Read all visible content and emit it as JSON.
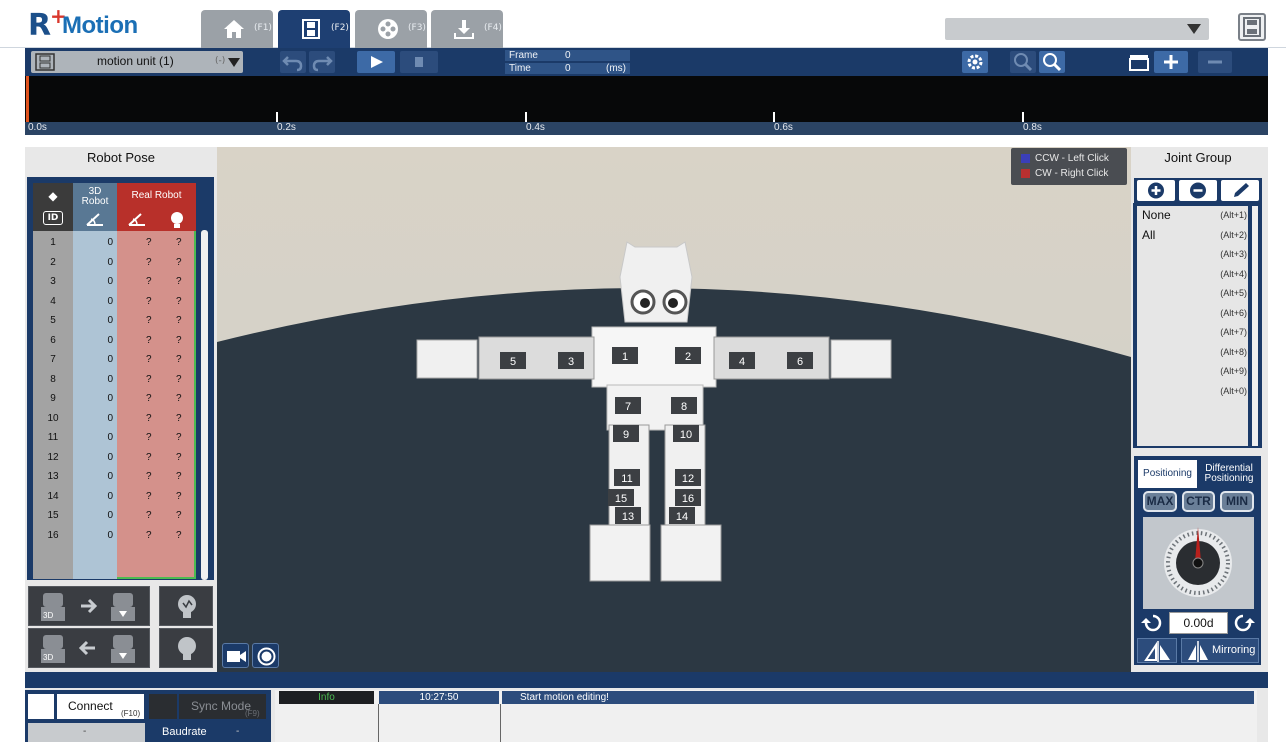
{
  "app": {
    "name": "Motion",
    "logo_r": "R",
    "logo_plus": "+"
  },
  "top_tabs": [
    {
      "icon": "home-icon",
      "key": "(F1)"
    },
    {
      "icon": "film-icon",
      "key": "(F2)"
    },
    {
      "icon": "film-reel-icon",
      "key": "(F3)"
    },
    {
      "icon": "download-icon",
      "key": "(F4)"
    }
  ],
  "toolbar": {
    "unit_label": "motion unit (1)",
    "unit_suffix": "(-)",
    "frame_label": "Frame",
    "frame_value": "0",
    "time_label": "Time",
    "time_value": "0",
    "time_unit": "(ms)"
  },
  "timeline": {
    "ticks": [
      "0.0s",
      "0.2s",
      "0.4s",
      "0.6s",
      "0.8s"
    ]
  },
  "robot_pose": {
    "title": "Robot Pose",
    "hdr_3d_a": "3D",
    "hdr_3d_b": "Robot",
    "hdr_real": "Real Robot",
    "hdr_id_badge": "ID",
    "rows": [
      {
        "id": "1",
        "v3d": "0",
        "ra": "?",
        "rl": "?"
      },
      {
        "id": "2",
        "v3d": "0",
        "ra": "?",
        "rl": "?"
      },
      {
        "id": "3",
        "v3d": "0",
        "ra": "?",
        "rl": "?"
      },
      {
        "id": "4",
        "v3d": "0",
        "ra": "?",
        "rl": "?"
      },
      {
        "id": "5",
        "v3d": "0",
        "ra": "?",
        "rl": "?"
      },
      {
        "id": "6",
        "v3d": "0",
        "ra": "?",
        "rl": "?"
      },
      {
        "id": "7",
        "v3d": "0",
        "ra": "?",
        "rl": "?"
      },
      {
        "id": "8",
        "v3d": "0",
        "ra": "?",
        "rl": "?"
      },
      {
        "id": "9",
        "v3d": "0",
        "ra": "?",
        "rl": "?"
      },
      {
        "id": "10",
        "v3d": "0",
        "ra": "?",
        "rl": "?"
      },
      {
        "id": "11",
        "v3d": "0",
        "ra": "?",
        "rl": "?"
      },
      {
        "id": "12",
        "v3d": "0",
        "ra": "?",
        "rl": "?"
      },
      {
        "id": "13",
        "v3d": "0",
        "ra": "?",
        "rl": "?"
      },
      {
        "id": "14",
        "v3d": "0",
        "ra": "?",
        "rl": "?"
      },
      {
        "id": "15",
        "v3d": "0",
        "ra": "?",
        "rl": "?"
      },
      {
        "id": "16",
        "v3d": "0",
        "ra": "?",
        "rl": "?"
      }
    ],
    "badge_3d": "3D"
  },
  "legend": {
    "ccw": "CCW  - Left Click",
    "cw": "CW   - Right Click",
    "ccw_color": "#3b3fb8",
    "cw_color": "#b83030"
  },
  "joint_labels": [
    "1",
    "2",
    "3",
    "4",
    "5",
    "6",
    "7",
    "8",
    "9",
    "10",
    "11",
    "12",
    "13",
    "14",
    "15",
    "16"
  ],
  "joint_group": {
    "title": "Joint Group",
    "items": [
      {
        "name": "None",
        "key": "(Alt+1)"
      },
      {
        "name": "All",
        "key": "(Alt+2)"
      },
      {
        "name": "",
        "key": "(Alt+3)"
      },
      {
        "name": "",
        "key": "(Alt+4)"
      },
      {
        "name": "",
        "key": "(Alt+5)"
      },
      {
        "name": "",
        "key": "(Alt+6)"
      },
      {
        "name": "",
        "key": "(Alt+7)"
      },
      {
        "name": "",
        "key": "(Alt+8)"
      },
      {
        "name": "",
        "key": "(Alt+9)"
      },
      {
        "name": "",
        "key": "(Alt+0)"
      }
    ]
  },
  "positioning": {
    "tab1": "Positioning",
    "tab2a": "Differential",
    "tab2b": "Positioning",
    "max": "MAX",
    "ctr": "CTR",
    "min": "MIN",
    "value": "0.00d",
    "mirroring": "Mirroring"
  },
  "bottom": {
    "connect": "Connect",
    "connect_key": "(F10)",
    "sync_mode": "Sync Mode",
    "sync_key": "(F9)",
    "port_value": "-",
    "baudrate": "Baudrate",
    "baud_value": "-",
    "log_type": "Info",
    "log_time": "10:27:50",
    "log_msg": "Start motion editing!"
  }
}
